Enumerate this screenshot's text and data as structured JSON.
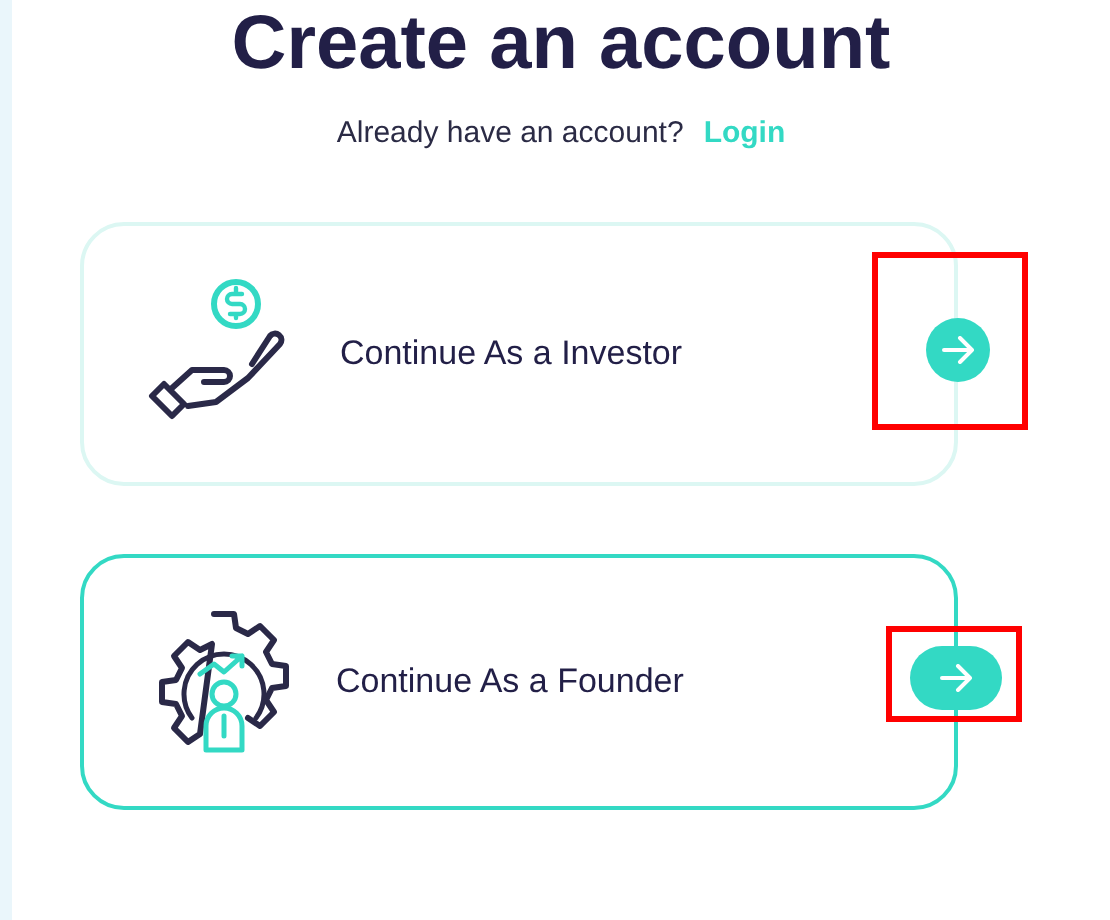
{
  "title": "Create an account",
  "login_prompt": {
    "text": "Already have an account?",
    "link": "Login"
  },
  "options": [
    {
      "kind": "investor",
      "label": "Continue As a Investor",
      "selected": false,
      "highlighted": true
    },
    {
      "kind": "founder",
      "label": "Continue As a Founder",
      "selected": true,
      "highlighted": true
    }
  ]
}
